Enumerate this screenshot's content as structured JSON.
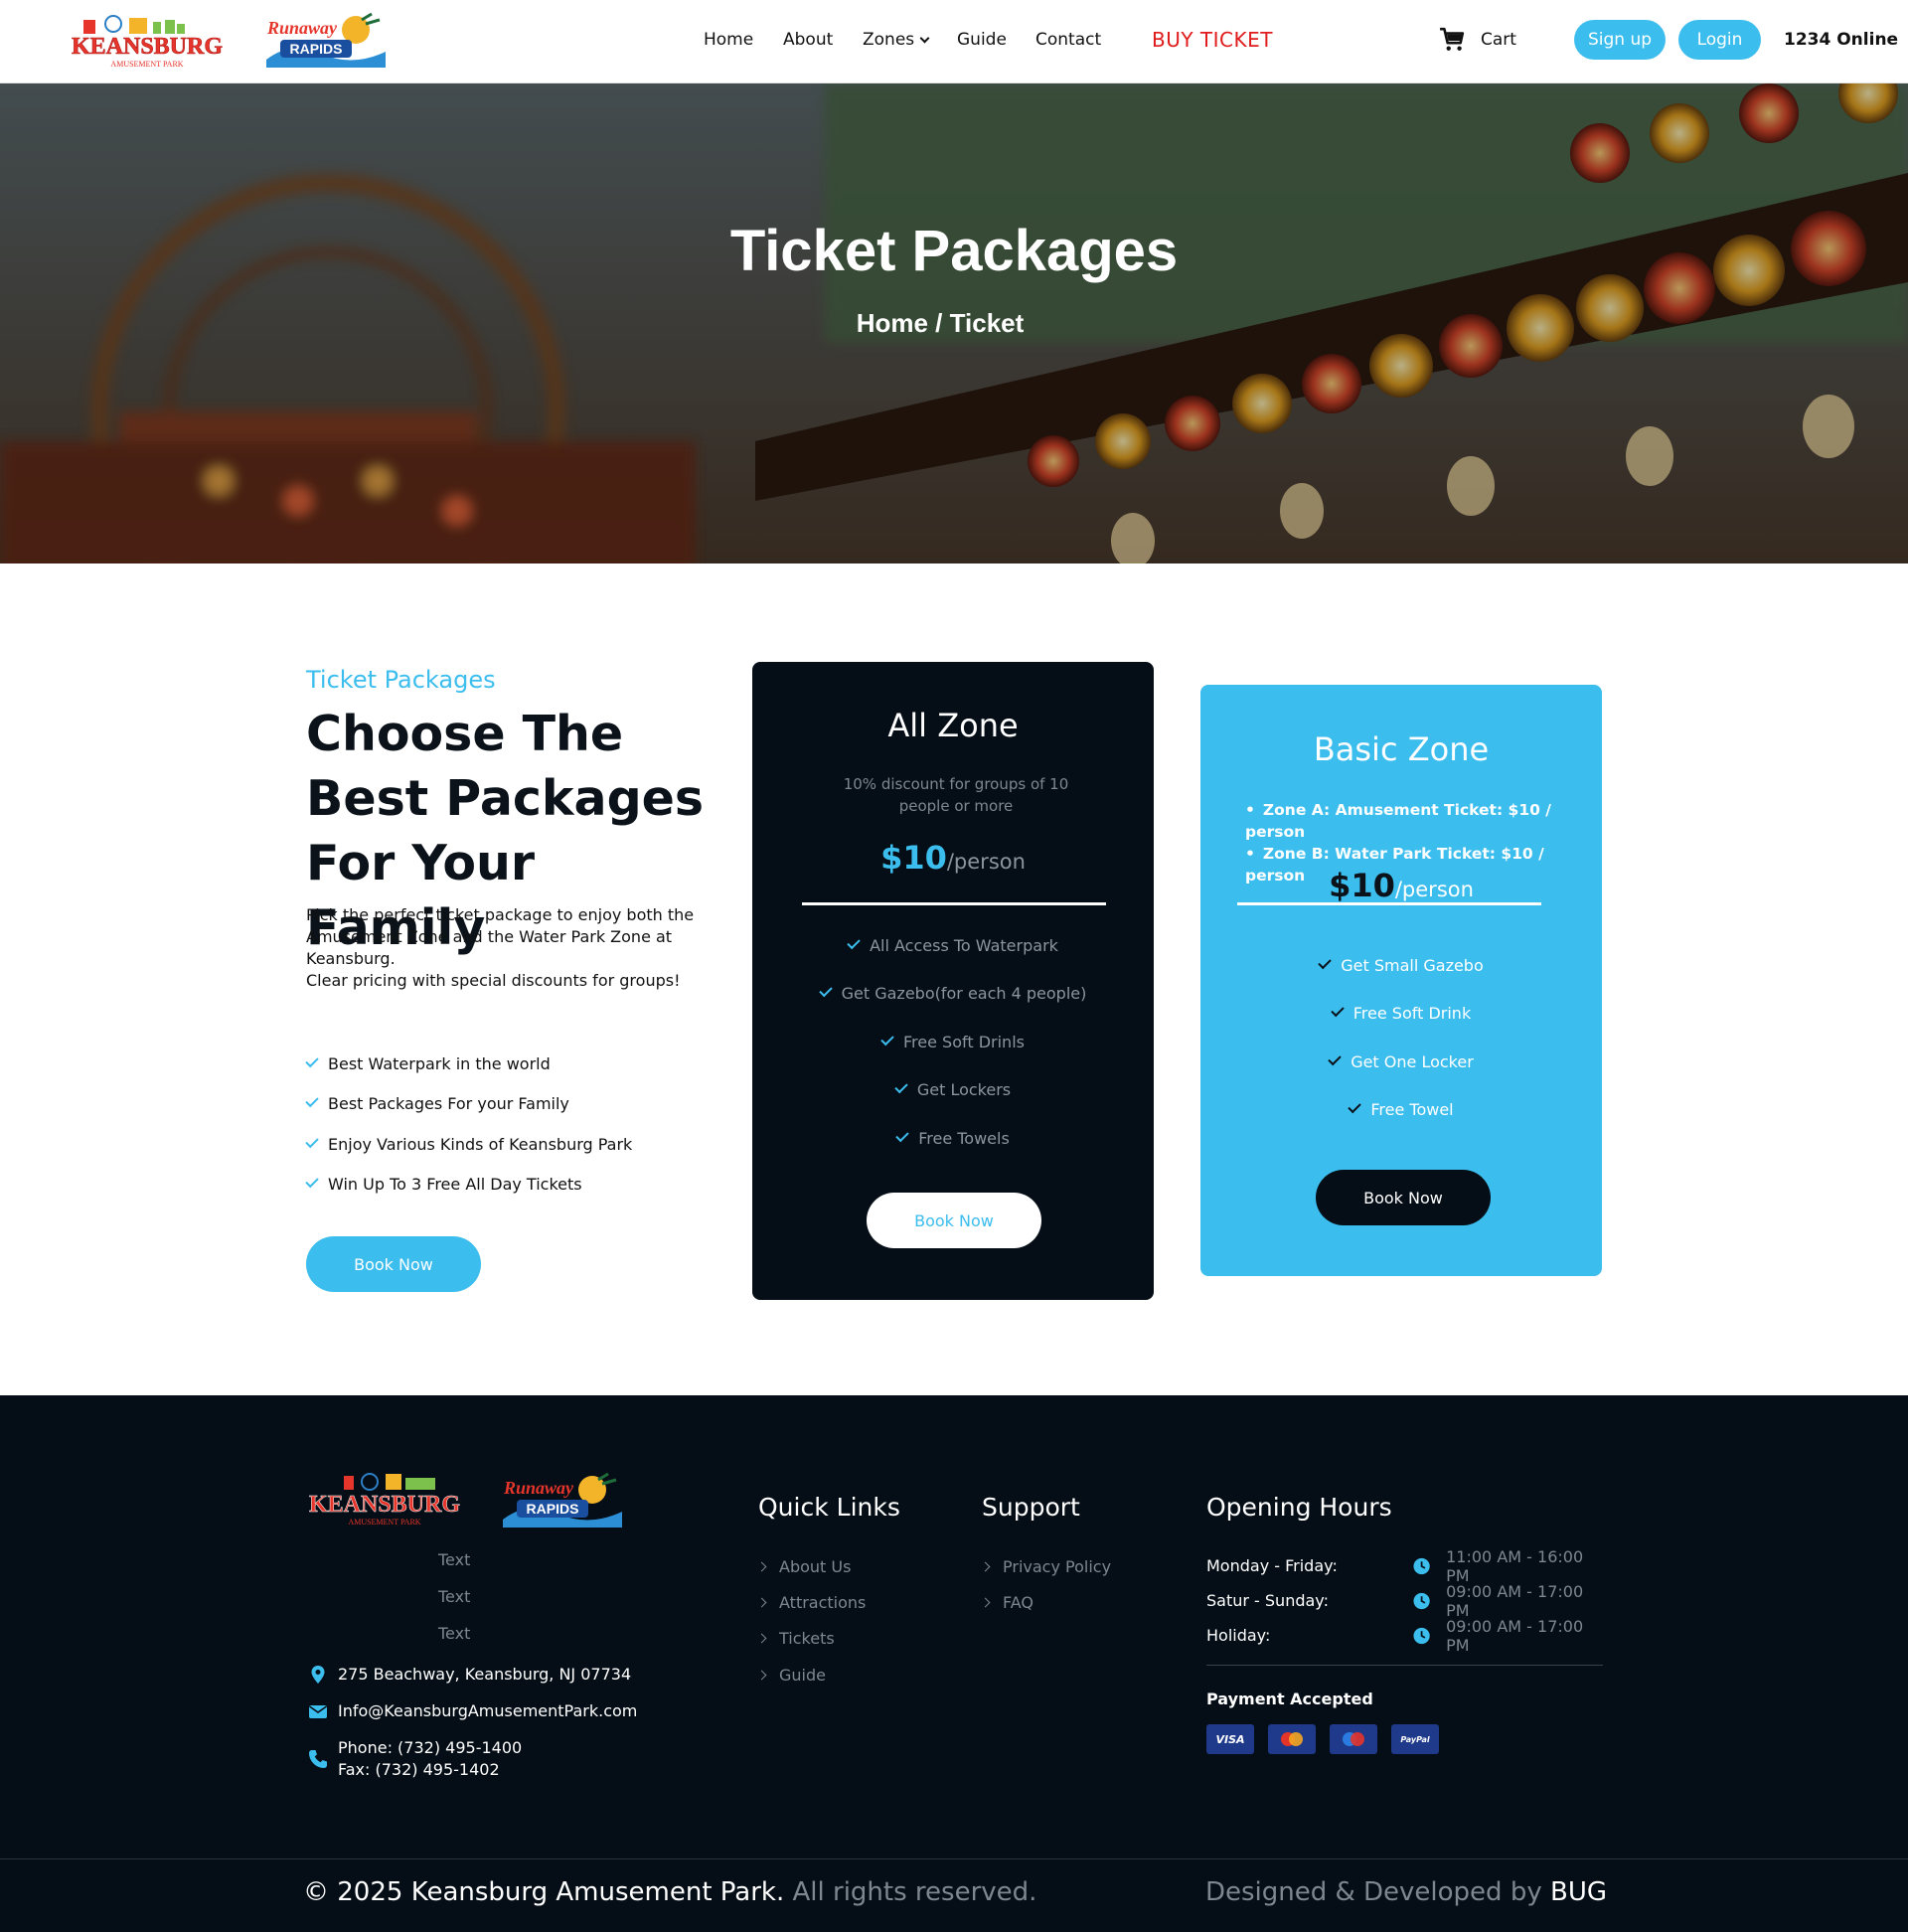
{
  "header": {
    "logos": {
      "keansburg": "KEANSBURG",
      "keansburg_sub": "AMUSEMENT PARK",
      "runaway": "Runaway",
      "runaway_sub": "RAPIDS"
    },
    "nav": {
      "home": "Home",
      "about": "About",
      "zones": "Zones",
      "guide": "Guide",
      "contact": "Contact",
      "buy_ticket": "BUY TICKET"
    },
    "cart_label": "Cart",
    "signup_label": "Sign up",
    "login_label": "Login",
    "online_count": "1234 Online"
  },
  "hero": {
    "title": "Ticket Packages",
    "breadcrumb": "Home / Ticket"
  },
  "packages": {
    "eyebrow": "Ticket Packages",
    "heading": "Choose The Best Packages For Your Family",
    "intro_line1": "Pick the perfect ticket package to enjoy both the Amusement Zone and the Water Park Zone at Keansburg.",
    "intro_line2": "Clear pricing with special discounts for groups!",
    "features": [
      "Best Waterpark in the world",
      "Best Packages For your Family",
      "Enjoy Various Kinds of Keansburg Park",
      "Win Up To 3 Free All Day Tickets"
    ],
    "book_label": "Book Now"
  },
  "cards": {
    "all_zone": {
      "title": "All Zone",
      "description": "10% discount for groups of 10 people or more",
      "price": "$10",
      "unit": "/person",
      "perks": [
        "All Access To Waterpark",
        "Get Gazebo(for each 4 people)",
        "Free Soft Drinls",
        "Get Lockers",
        "Free Towels"
      ],
      "book_label": "Book Now"
    },
    "basic_zone": {
      "title": "Basic Zone",
      "zones": [
        "Zone A: Amusement Ticket: $10 / person",
        "Zone B: Water Park Ticket: $10 / person"
      ],
      "price": "$10",
      "unit": "/person",
      "perks": [
        "Get Small Gazebo",
        "Free Soft Drink",
        "Get One Locker",
        "Free Towel"
      ],
      "book_label": "Book Now"
    }
  },
  "footer": {
    "texts": [
      "Text",
      "Text",
      "Text"
    ],
    "address": "275 Beachway, Keansburg, NJ 07734",
    "email": "Info@KeansburgAmusementPark.com",
    "phone": "Phone: (732) 495-1400",
    "fax": "Fax: (732) 495-1402",
    "quick_links_title": "Quick Links",
    "quick_links": [
      "About Us",
      "Attractions",
      "Tickets",
      "Guide"
    ],
    "support_title": "Support",
    "support_links": [
      "Privacy Policy",
      "FAQ"
    ],
    "hours_title": "Opening Hours",
    "hours": [
      {
        "day": "Monday - Friday:",
        "time": "11:00 AM - 16:00 PM"
      },
      {
        "day": "Satur - Sunday:",
        "time": "09:00 AM - 17:00 PM"
      },
      {
        "day": "Holiday:",
        "time": "09:00 AM - 17:00 PM"
      }
    ],
    "payment_title": "Payment Accepted",
    "payment_methods": [
      "VISA",
      "MasterCard",
      "Maestro",
      "PayPal"
    ],
    "copyright_main": "© 2025 Keansburg Amusement Park.",
    "copyright_rest": " All rights reserved.",
    "credit_prefix": "Designed & Developed by ",
    "credit_name": "BUG"
  },
  "colors": {
    "accent": "#3bbdee",
    "dark": "#050e16",
    "buy_ticket": "#e01b1b"
  },
  "icons": [
    "cart-icon",
    "chevron-down-icon",
    "check-icon",
    "location-pin-icon",
    "envelope-icon",
    "phone-icon",
    "clock-icon",
    "chevron-right-icon"
  ]
}
